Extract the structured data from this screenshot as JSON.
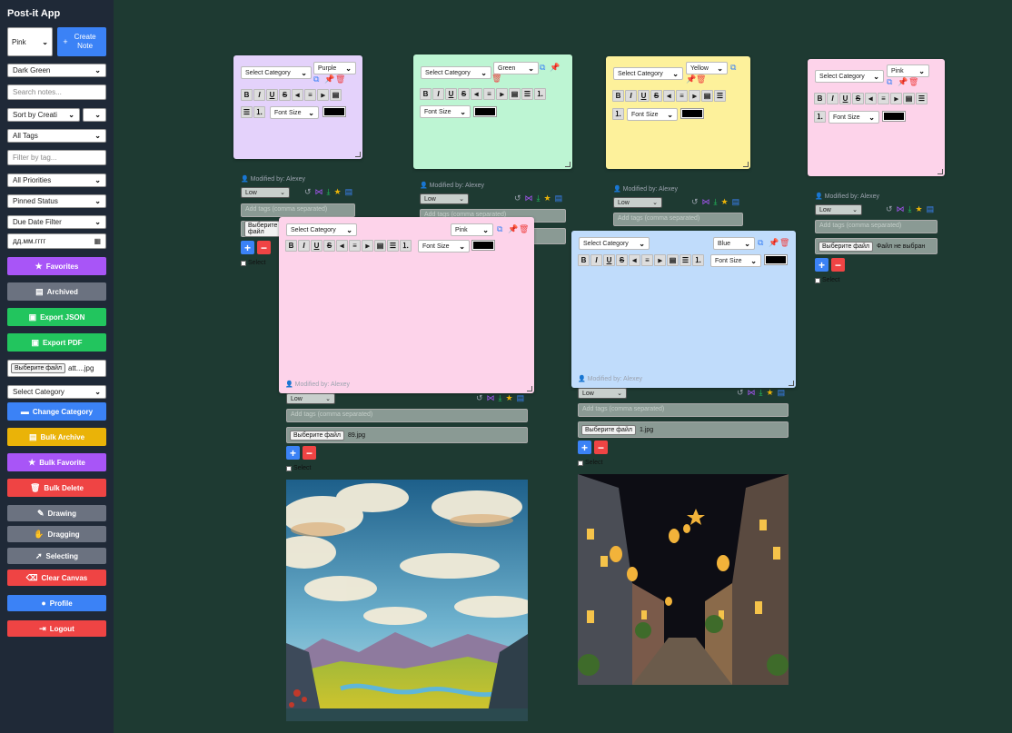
{
  "app": {
    "title": "Post-it App"
  },
  "sidebar": {
    "color_select": "Pink",
    "create_note": "Create Note",
    "theme_select": "Dark Green",
    "search_placeholder": "Search notes...",
    "sort_select": "Sort by Creati",
    "tags_select": "All Tags",
    "tag_filter_placeholder": "Filter by tag...",
    "priority_select": "All Priorities",
    "pinned_select": "Pinned Status",
    "due_select": "Due Date Filter",
    "date_placeholder": "дд.мм.гггг",
    "favorites": "Favorites",
    "archived": "Archived",
    "export_json": "Export JSON",
    "export_pdf": "Export PDF",
    "file_button": "Выберите файл",
    "file_name": "att....jpg",
    "category_select": "Select Category",
    "change_category": "Change Category",
    "bulk_archive": "Bulk Archive",
    "bulk_favorite": "Bulk Favorite",
    "bulk_delete": "Bulk Delete",
    "drawing": "Drawing",
    "dragging": "Dragging",
    "selecting": "Selecting",
    "clear_canvas": "Clear Canvas",
    "profile": "Profile",
    "logout": "Logout"
  },
  "colors": {
    "purple": "#e4d2fb",
    "green": "#bdf5d3",
    "yellow": "#fdf19b",
    "pink": "#fdd3ea",
    "blue": "#c0dcfb",
    "bg": "#1e3a32",
    "sidebar": "#1f2937"
  },
  "note_common": {
    "category": "Select Category",
    "font_size": "Font Size",
    "modified": "Modified by: Alexey",
    "priority": "Low",
    "tags_placeholder": "Add tags (comma separated)",
    "file_button": "Выберите файл",
    "select": "Select"
  },
  "notes": [
    {
      "id": "purple",
      "color_label": "Purple"
    },
    {
      "id": "green",
      "color_label": "Green"
    },
    {
      "id": "yellow",
      "color_label": "Yellow"
    },
    {
      "id": "pink-right",
      "color_label": "Pink",
      "file_name": "Файл не выбран"
    },
    {
      "id": "pink-center",
      "color_label": "Pink",
      "file_name": "89.jpg"
    },
    {
      "id": "blue",
      "color_label": "Blue",
      "file_name": "1.jpg"
    }
  ],
  "images": [
    {
      "name": "landscape-image",
      "description": "anime landscape"
    },
    {
      "name": "night-street-image",
      "description": "night street with lanterns"
    }
  ]
}
